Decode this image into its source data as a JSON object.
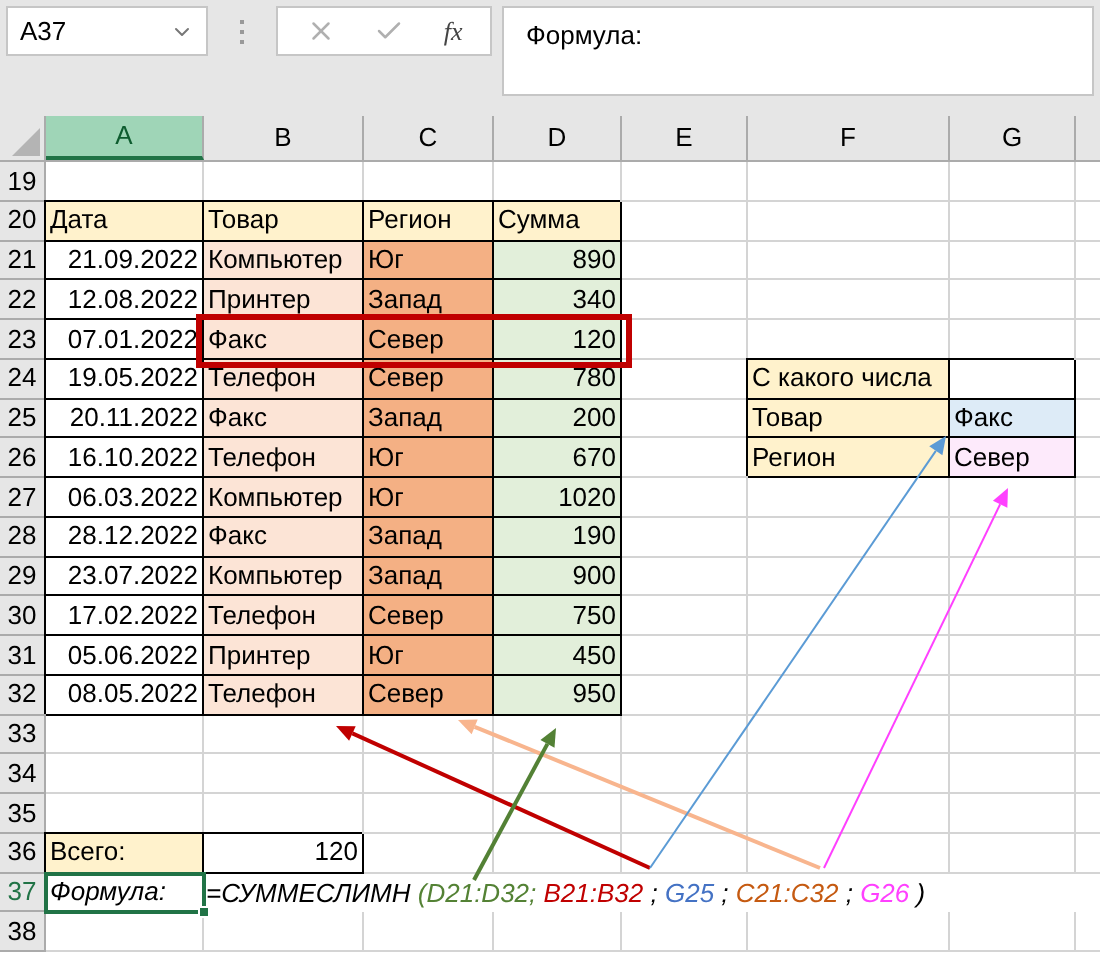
{
  "name_box": {
    "value": "A37"
  },
  "formula_bar": {
    "fx_label": "fx",
    "value": "Формула:"
  },
  "columns": [
    {
      "label": "A",
      "selected": true
    },
    {
      "label": "B",
      "selected": false
    },
    {
      "label": "C",
      "selected": false
    },
    {
      "label": "D",
      "selected": false
    },
    {
      "label": "E",
      "selected": false
    },
    {
      "label": "F",
      "selected": false
    },
    {
      "label": "G",
      "selected": false
    }
  ],
  "rows": [
    {
      "number": "19",
      "highlighted": false,
      "cells": []
    },
    {
      "number": "20",
      "highlighted": false,
      "cells": [
        {
          "text": "Дата",
          "kind": "head"
        },
        {
          "text": "Товар",
          "kind": "head"
        },
        {
          "text": "Регион",
          "kind": "head"
        },
        {
          "text": "Сумма",
          "kind": "head"
        }
      ]
    },
    {
      "number": "21",
      "highlighted": false,
      "cells": [
        {
          "text": "21.09.2022",
          "kind": "date"
        },
        {
          "text": "Компьютер",
          "kind": "item"
        },
        {
          "text": "Юг",
          "kind": "region"
        },
        {
          "text": "890",
          "kind": "amount"
        }
      ]
    },
    {
      "number": "22",
      "highlighted": false,
      "cells": [
        {
          "text": "12.08.2022",
          "kind": "date"
        },
        {
          "text": "Принтер",
          "kind": "item"
        },
        {
          "text": "Запад",
          "kind": "region"
        },
        {
          "text": "340",
          "kind": "amount"
        }
      ]
    },
    {
      "number": "23",
      "highlighted": true,
      "cells": [
        {
          "text": "07.01.2022",
          "kind": "date"
        },
        {
          "text": "Факс",
          "kind": "item"
        },
        {
          "text": "Север",
          "kind": "region"
        },
        {
          "text": "120",
          "kind": "amount"
        }
      ]
    },
    {
      "number": "24",
      "highlighted": false,
      "cells": [
        {
          "text": "19.05.2022",
          "kind": "date"
        },
        {
          "text": "Телефон",
          "kind": "item"
        },
        {
          "text": "Север",
          "kind": "region"
        },
        {
          "text": "780",
          "kind": "amount"
        },
        null,
        {
          "text": "С какого числа",
          "kind": "label"
        },
        {
          "text": "",
          "kind": "blank"
        }
      ]
    },
    {
      "number": "25",
      "highlighted": false,
      "cells": [
        {
          "text": "20.11.2022",
          "kind": "date"
        },
        {
          "text": "Факс",
          "kind": "item"
        },
        {
          "text": "Запад",
          "kind": "region"
        },
        {
          "text": "200",
          "kind": "amount"
        },
        null,
        {
          "text": "Товар",
          "kind": "label"
        },
        {
          "text": "Факс",
          "kind": "criterion-blue"
        }
      ]
    },
    {
      "number": "26",
      "highlighted": false,
      "cells": [
        {
          "text": "16.10.2022",
          "kind": "date"
        },
        {
          "text": "Телефон",
          "kind": "item"
        },
        {
          "text": "Юг",
          "kind": "region"
        },
        {
          "text": "670",
          "kind": "amount"
        },
        null,
        {
          "text": "Регион",
          "kind": "label"
        },
        {
          "text": "Север",
          "kind": "criterion-pink"
        }
      ]
    },
    {
      "number": "27",
      "highlighted": false,
      "cells": [
        {
          "text": "06.03.2022",
          "kind": "date"
        },
        {
          "text": "Компьютер",
          "kind": "item"
        },
        {
          "text": "Юг",
          "kind": "region"
        },
        {
          "text": "1020",
          "kind": "amount"
        }
      ]
    },
    {
      "number": "28",
      "highlighted": false,
      "cells": [
        {
          "text": "28.12.2022",
          "kind": "date"
        },
        {
          "text": "Факс",
          "kind": "item"
        },
        {
          "text": "Запад",
          "kind": "region"
        },
        {
          "text": "190",
          "kind": "amount"
        }
      ]
    },
    {
      "number": "29",
      "highlighted": false,
      "cells": [
        {
          "text": "23.07.2022",
          "kind": "date"
        },
        {
          "text": "Компьютер",
          "kind": "item"
        },
        {
          "text": "Запад",
          "kind": "region"
        },
        {
          "text": "900",
          "kind": "amount"
        }
      ]
    },
    {
      "number": "30",
      "highlighted": false,
      "cells": [
        {
          "text": "17.02.2022",
          "kind": "date"
        },
        {
          "text": "Телефон",
          "kind": "item"
        },
        {
          "text": "Север",
          "kind": "region"
        },
        {
          "text": "750",
          "kind": "amount"
        }
      ]
    },
    {
      "number": "31",
      "highlighted": false,
      "cells": [
        {
          "text": "05.06.2022",
          "kind": "date"
        },
        {
          "text": "Принтер",
          "kind": "item"
        },
        {
          "text": "Юг",
          "kind": "region"
        },
        {
          "text": "450",
          "kind": "amount"
        }
      ]
    },
    {
      "number": "32",
      "highlighted": false,
      "cells": [
        {
          "text": "08.05.2022",
          "kind": "date"
        },
        {
          "text": "Телефон",
          "kind": "item"
        },
        {
          "text": "Север",
          "kind": "region"
        },
        {
          "text": "950",
          "kind": "amount"
        }
      ]
    },
    {
      "number": "33",
      "highlighted": false,
      "cells": []
    },
    {
      "number": "34",
      "highlighted": false,
      "cells": []
    },
    {
      "number": "35",
      "highlighted": false,
      "cells": []
    },
    {
      "number": "36",
      "highlighted": false,
      "cells": [
        {
          "text": "Всего:",
          "kind": "total-label"
        },
        {
          "text": "120",
          "kind": "total"
        }
      ]
    },
    {
      "number": "37",
      "highlighted": false,
      "selected": true,
      "cells": [
        {
          "text": "Формула:",
          "kind": "formula-label",
          "selected": true
        }
      ],
      "formula": [
        {
          "text": "=СУММЕСЛИМН ",
          "color": "#000000"
        },
        {
          "text": "(D21:D32;",
          "color": "#548235"
        },
        {
          "text": " B21:B32",
          "color": "#c00000"
        },
        {
          "text": " ;",
          "color": "#000000"
        },
        {
          "text": " G25",
          "color": "#4472c4"
        },
        {
          "text": " ;",
          "color": "#000000"
        },
        {
          "text": " C21:C32",
          "color": "#c55a11"
        },
        {
          "text": " ;",
          "color": "#000000"
        },
        {
          "text": " G26",
          "color": "#ff40ff"
        },
        {
          "text": " )",
          "color": "#000000"
        }
      ]
    },
    {
      "number": "38",
      "highlighted": false,
      "cells": []
    }
  ]
}
